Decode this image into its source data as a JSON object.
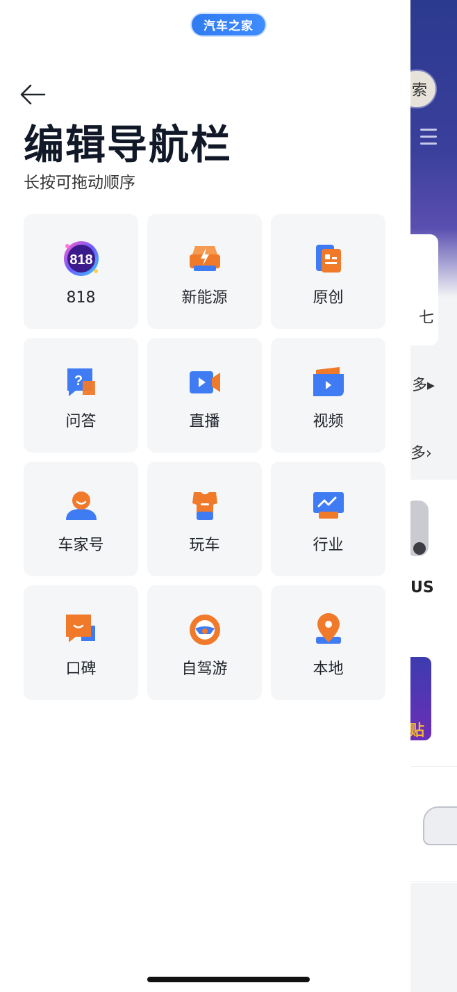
{
  "brand": "汽车之家",
  "title": "编辑导航栏",
  "subtitle": "长按可拖动顺序",
  "nav_items": [
    {
      "label": "818",
      "icon": "badge-818-icon"
    },
    {
      "label": "新能源",
      "icon": "ev-charge-icon"
    },
    {
      "label": "原创",
      "icon": "document-icon"
    },
    {
      "label": "问答",
      "icon": "question-bubble-icon"
    },
    {
      "label": "直播",
      "icon": "live-camera-icon"
    },
    {
      "label": "视频",
      "icon": "video-play-icon"
    },
    {
      "label": "车家号",
      "icon": "person-icon"
    },
    {
      "label": "玩车",
      "icon": "tshirt-icon"
    },
    {
      "label": "行业",
      "icon": "chart-trend-icon"
    },
    {
      "label": "口碑",
      "icon": "comment-bubble-icon"
    },
    {
      "label": "自驾游",
      "icon": "steering-wheel-icon"
    },
    {
      "label": "本地",
      "icon": "location-pin-icon"
    }
  ],
  "background": {
    "search_char": "索",
    "card_char": "七",
    "more_label_1": "多",
    "more_label_2": "多",
    "model_text": "US",
    "promo_text": "贴"
  },
  "colors": {
    "accent_blue": "#3f7cf4",
    "accent_orange": "#f07a2a",
    "tile_bg": "#f5f6f8",
    "title_color": "#111827"
  }
}
